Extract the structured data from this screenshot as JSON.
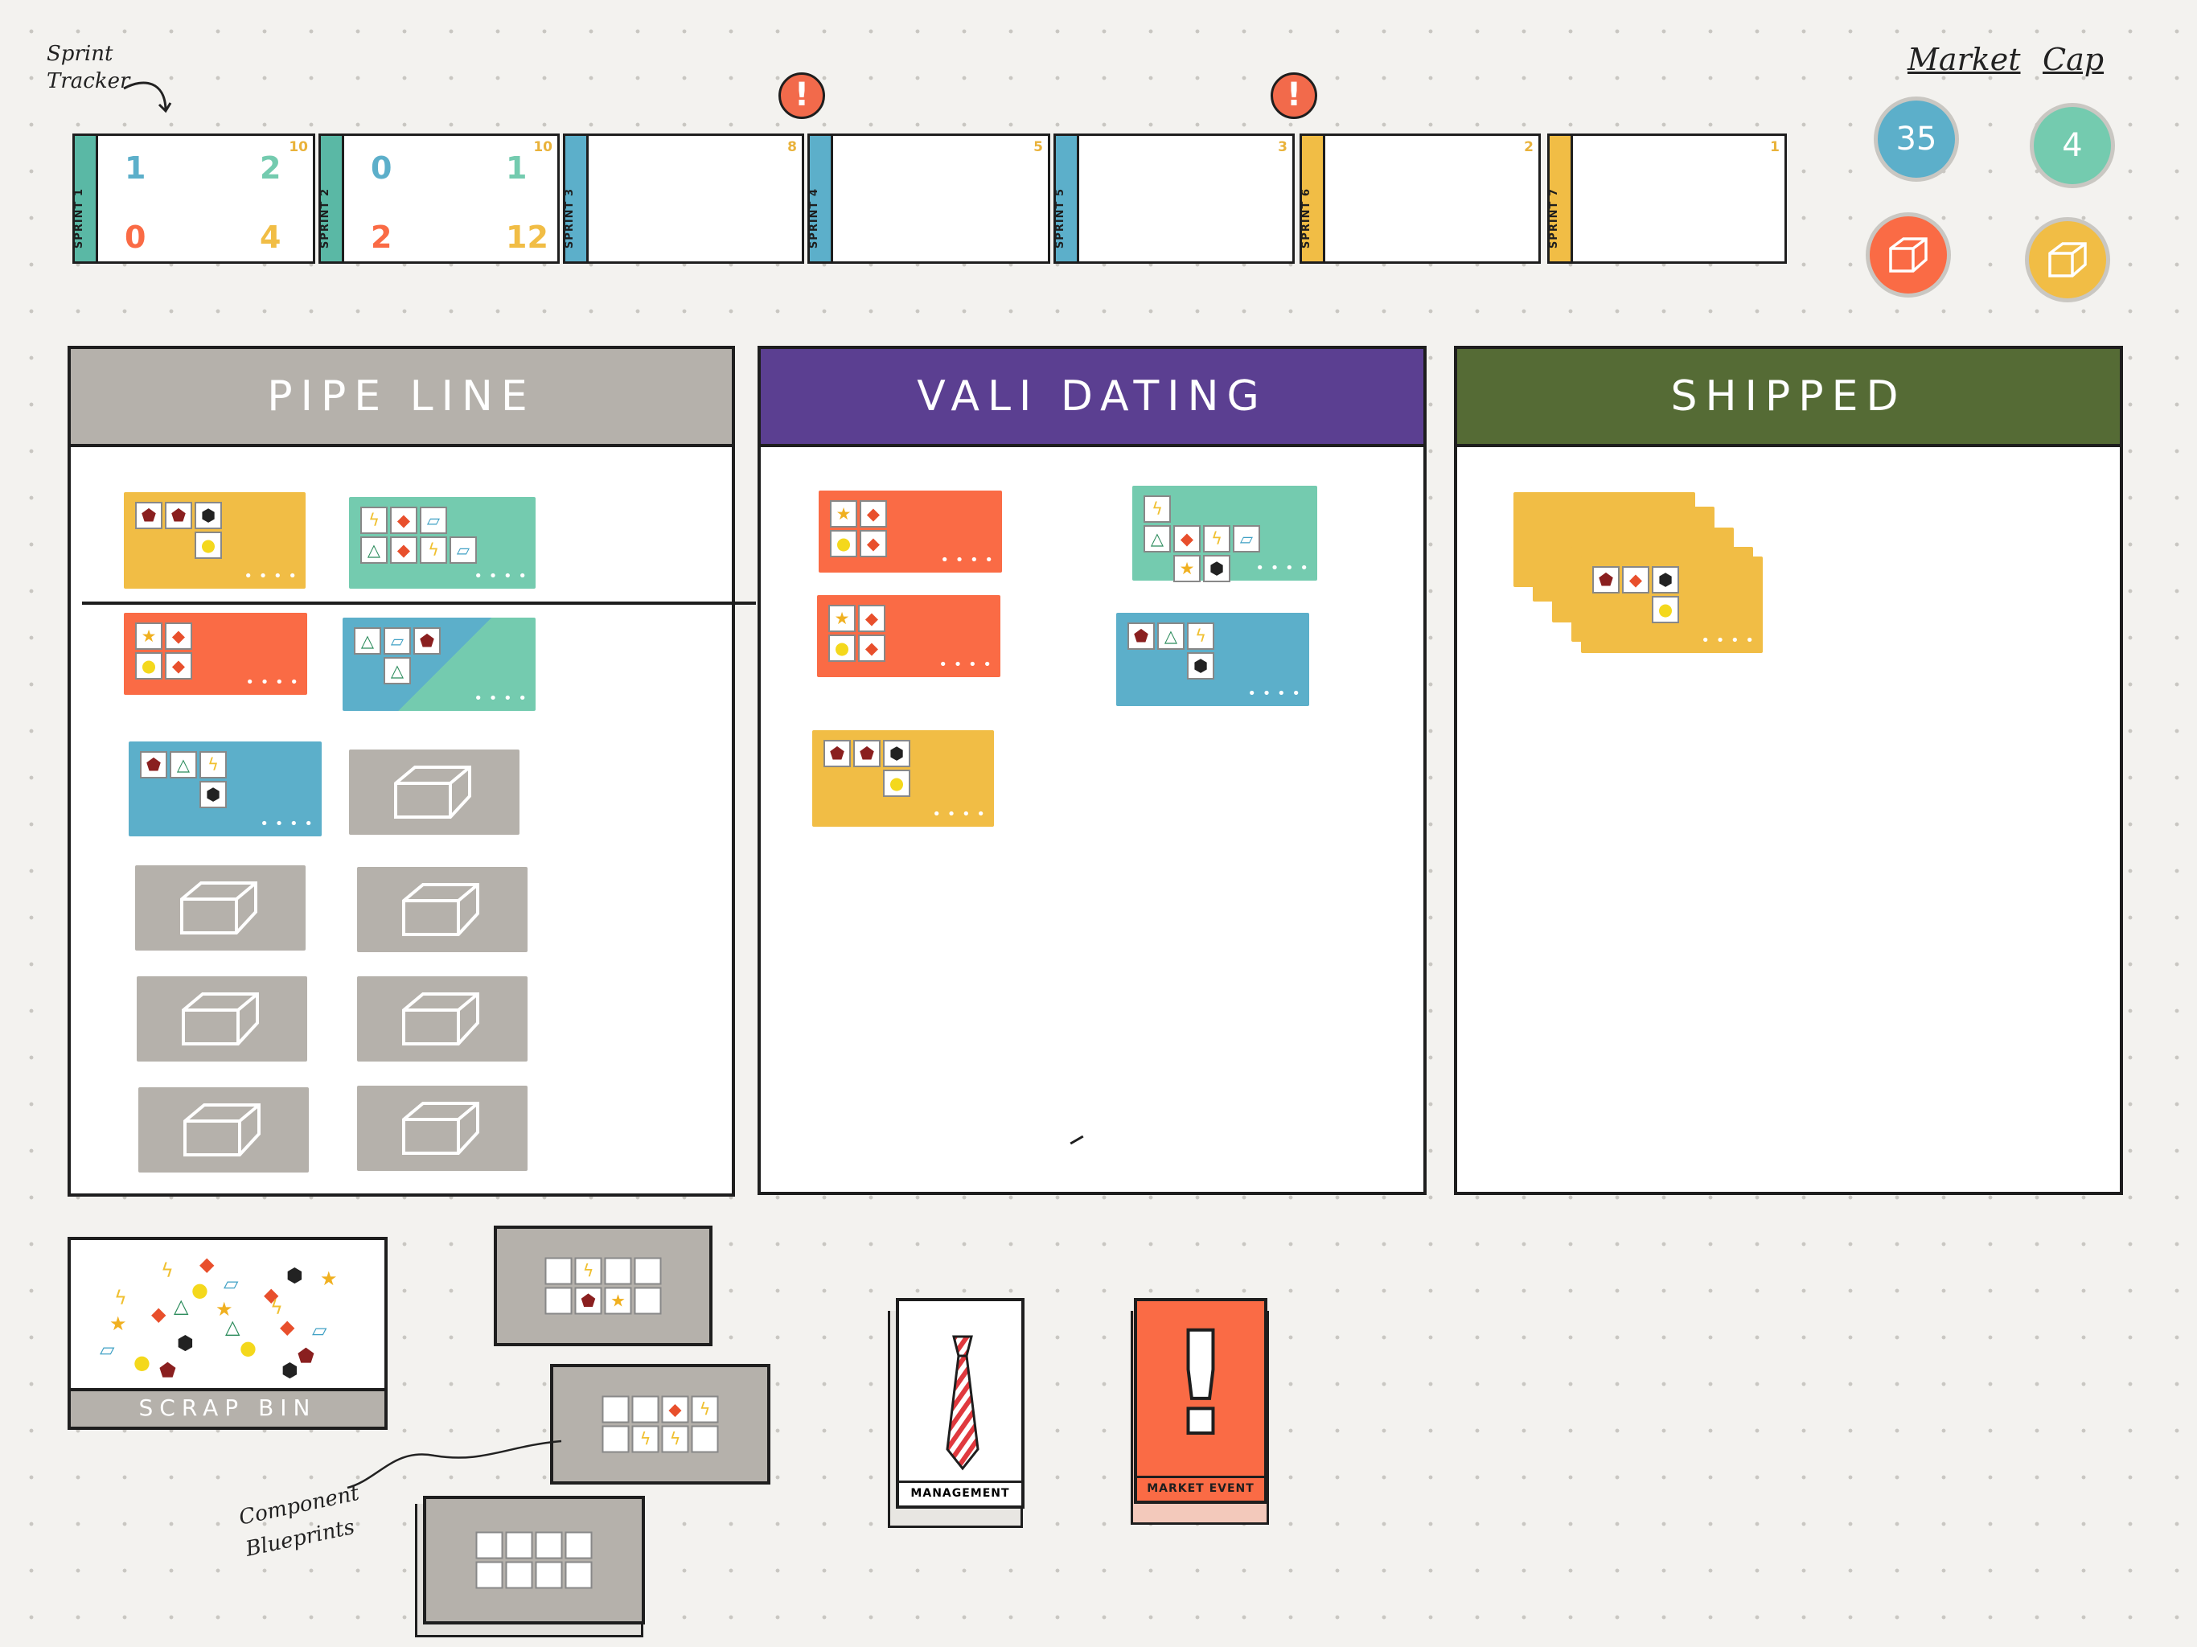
{
  "tracker": {
    "label": "Sprint Tracker",
    "sprints": [
      {
        "name": "SPRINT 1",
        "cap": "10",
        "color": "#5ab8a5",
        "values": [
          {
            "v": "1",
            "c": "#5cafca"
          },
          {
            "v": "2",
            "c": "#74cbaf"
          },
          {
            "v": "0",
            "c": "#fa6b45"
          },
          {
            "v": "4",
            "c": "#f1bd45"
          }
        ]
      },
      {
        "name": "SPRINT 2",
        "cap": "10",
        "color": "#5ab8a5",
        "values": [
          {
            "v": "0",
            "c": "#5cafca"
          },
          {
            "v": "1",
            "c": "#74cbaf"
          },
          {
            "v": "2",
            "c": "#fa6b45"
          },
          {
            "v": "12",
            "c": "#f1bd45"
          }
        ]
      },
      {
        "name": "SPRINT 3",
        "cap": "8",
        "color": "#5cafca",
        "values": []
      },
      {
        "name": "SPRINT 4",
        "cap": "5",
        "color": "#5cafca",
        "values": []
      },
      {
        "name": "SPRINT 5",
        "cap": "3",
        "color": "#5cafca",
        "values": []
      },
      {
        "name": "SPRINT 6",
        "cap": "2",
        "color": "#f1bd45",
        "values": []
      },
      {
        "name": "SPRINT 7",
        "cap": "1",
        "color": "#f1bd45",
        "values": []
      }
    ],
    "alert_glyph": "!"
  },
  "market_cap": {
    "heading_left": "Market",
    "heading_right": "Cap",
    "blue_value": "35",
    "teal_value": "4",
    "colors": {
      "blue": "#5cafca",
      "teal": "#74cbaf",
      "red": "#fa6b45",
      "yellow": "#f1bd45"
    },
    "cube_icons": [
      "cube-icon",
      "cube-icon"
    ]
  },
  "columns": {
    "pipeline": {
      "title": "PIPE LINE",
      "color": "#b5b1ab"
    },
    "validating": {
      "title": "VALI DATING",
      "color": "#5b3f91"
    },
    "shipped": {
      "title": "SHIPPED",
      "color": "#556b35"
    }
  },
  "icons": {
    "pentagon": "⬟",
    "nut": "◆",
    "bolt": "ϟ",
    "triangle": "△",
    "star": "★",
    "dot": "●",
    "para": "▱",
    "plug": "⬢",
    "cube": "⧈"
  },
  "card_dots": "• • • •",
  "scrap_bin": {
    "label": "SCRAP BIN"
  },
  "blueprints": {
    "label": "Component Blueprints"
  },
  "decks": {
    "management": "MANAGEMENT",
    "market_event": "MARKET EVENT",
    "exclamation": "!"
  }
}
